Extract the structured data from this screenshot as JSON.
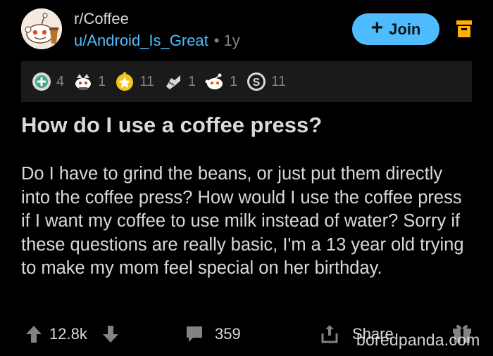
{
  "header": {
    "subreddit": "r/Coffee",
    "username": "u/Android_Is_Great",
    "separator": "•",
    "age": "1y",
    "join_label": "Join"
  },
  "awards": [
    {
      "icon": "helpful-award-icon",
      "count": "4"
    },
    {
      "icon": "doge-award-icon",
      "count": "1"
    },
    {
      "icon": "wholesome-award-icon",
      "count": "11"
    },
    {
      "icon": "bless-up-award-icon",
      "count": "1"
    },
    {
      "icon": "snoo-award-icon",
      "count": "1"
    },
    {
      "icon": "silver-award-icon",
      "count": "11"
    }
  ],
  "post": {
    "title": "How do I use a coffee press?",
    "body": "Do I have to grind the beans, or just put them directly into the coffee press? How would I use the coffee press if I want my coffee to use milk instead of water? Sorry if these questions are really basic, I'm a 13 year old trying to make my mom feel special on her birthday."
  },
  "footer": {
    "score": "12.8k",
    "comments": "359",
    "share_label": "Share"
  },
  "watermark": "boredpanda.com",
  "colors": {
    "background": "#000000",
    "text": "#d7dadc",
    "muted": "#818384",
    "link": "#4fbcff",
    "join_button": "#4fbcff",
    "awards_bar": "#1a1a1b",
    "archive_icon": "#ffb000"
  }
}
